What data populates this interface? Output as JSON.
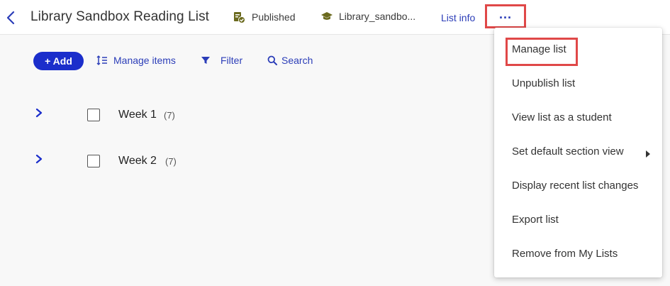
{
  "header": {
    "title": "Library Sandbox Reading List",
    "status_label": "Published",
    "course_label": "Library_sandbo...",
    "list_info_label": "List info",
    "more_label": "..."
  },
  "toolbar": {
    "add_label": "+ Add",
    "manage_items_label": "Manage items",
    "filter_label": "Filter",
    "search_label": "Search"
  },
  "sections": [
    {
      "label": "Week 1",
      "count": "(7)"
    },
    {
      "label": "Week 2",
      "count": "(7)"
    }
  ],
  "menu": {
    "items": [
      {
        "label": "Manage list"
      },
      {
        "label": "Unpublish list"
      },
      {
        "label": "View list as a student"
      },
      {
        "label": "Set default section view"
      },
      {
        "label": "Display recent list changes"
      },
      {
        "label": "Export list"
      },
      {
        "label": "Remove from My Lists"
      }
    ]
  },
  "colors": {
    "accent": "#1b2ecb",
    "link": "#2b3db8",
    "highlight": "#e04848",
    "status_icon": "#6b6a1e"
  },
  "icons": {
    "back": "chevron-left-icon",
    "status": "published-clipboard-icon",
    "course": "graduation-cap-icon",
    "manage_items": "sort-list-icon",
    "filter": "filter-funnel-icon",
    "search": "search-icon",
    "expand": "chevron-right-icon",
    "submenu": "caret-right-icon"
  }
}
